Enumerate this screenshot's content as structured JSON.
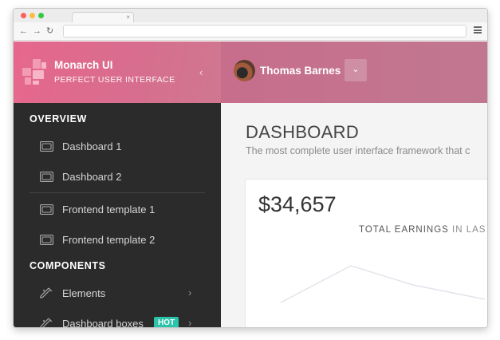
{
  "browser": {
    "tab_close": "×",
    "nav": {
      "back": "←",
      "forward": "→",
      "reload": "↻"
    },
    "traffic_lights": [
      "#fc605c",
      "#fdbc40",
      "#34c84a"
    ]
  },
  "brand": {
    "name": "Monarch UI",
    "tagline": "PERFECT USER INTERFACE",
    "collapse_icon": "‹",
    "color_start": "#e7678d",
    "color_end": "#cf7790"
  },
  "sidebar": {
    "sections": [
      {
        "title": "OVERVIEW"
      },
      {
        "title": "COMPONENTS"
      }
    ],
    "items": [
      {
        "label": "Dashboard 1",
        "icon": "monitor-icon"
      },
      {
        "label": "Dashboard 2",
        "icon": "monitor-icon"
      },
      {
        "label": "Frontend template 1",
        "icon": "monitor-icon"
      },
      {
        "label": "Frontend template 2",
        "icon": "monitor-icon"
      },
      {
        "label": "Elements",
        "icon": "flask-icon",
        "chevron": "›"
      },
      {
        "label": "Dashboard boxes",
        "icon": "flask-icon",
        "badge": "HOT",
        "chevron": "›"
      }
    ],
    "badge_color": "#2bc3a9",
    "background": "#2b2b2c"
  },
  "user": {
    "name": "Thomas Barnes",
    "dropdown_icon": "⌄"
  },
  "main": {
    "title": "DASHBOARD",
    "subtitle": "The most complete user interface framework that c",
    "card": {
      "value": "$34,657",
      "label_strong": "TOTAL EARNINGS",
      "label_muted": " IN LAS"
    }
  }
}
